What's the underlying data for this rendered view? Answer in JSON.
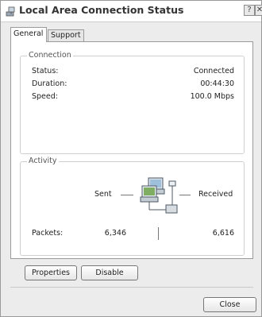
{
  "window": {
    "title": "Local Area Connection Status",
    "help_button": "?",
    "close_button": "✕"
  },
  "tabs": [
    {
      "label": "General",
      "active": true
    },
    {
      "label": "Support",
      "active": false
    }
  ],
  "connection": {
    "legend": "Connection",
    "status_label": "Status:",
    "status_value": "Connected",
    "duration_label": "Duration:",
    "duration_value": "00:44:30",
    "speed_label": "Speed:",
    "speed_value": "100.0 Mbps"
  },
  "activity": {
    "legend": "Activity",
    "sent_label": "Sent",
    "received_label": "Received",
    "packets_label": "Packets:",
    "packets_sent": "6,346",
    "packets_received": "6,616",
    "icon": "network-computers-icon"
  },
  "buttons": {
    "properties": "Properties",
    "disable": "Disable",
    "close": "Close"
  },
  "colors": {
    "panel_bg": "#ffffff",
    "window_bg": "#ececec",
    "border": "#9a9a9a"
  }
}
